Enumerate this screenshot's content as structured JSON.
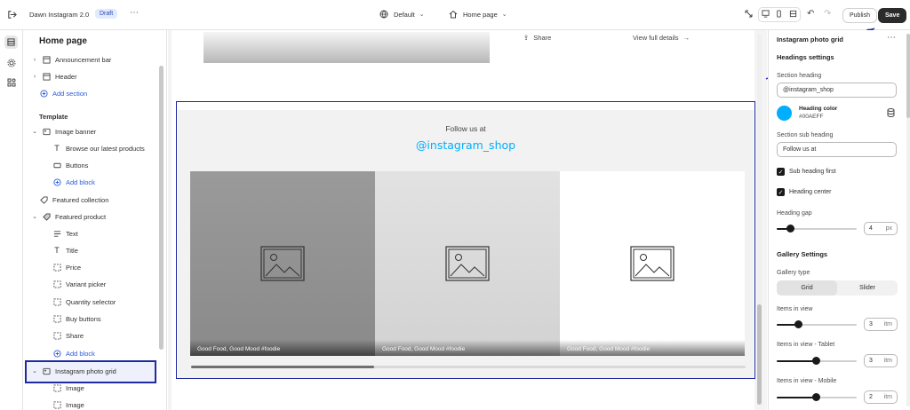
{
  "topbar": {
    "store_name": "Dawn Instagram 2.0",
    "status_badge": "Draft",
    "theme_select": "Default",
    "page_select": "Home page",
    "publish_label": "Publish",
    "save_label": "Save"
  },
  "sidebar": {
    "title": "Home page",
    "header_items": [
      {
        "label": "Announcement bar",
        "icon": "layout-icon"
      },
      {
        "label": "Header",
        "icon": "layout-icon"
      }
    ],
    "add_section_header": "Add section",
    "template_label": "Template",
    "image_banner": {
      "label": "Image banner",
      "blocks": [
        "Browse our latest products",
        "Buttons"
      ],
      "add_block": "Add block"
    },
    "featured_collection": "Featured collection",
    "featured_product": {
      "label": "Featured product",
      "blocks": [
        "Text",
        "Title",
        "Price",
        "Variant picker",
        "Quantity selector",
        "Buy buttons",
        "Share"
      ],
      "add_block": "Add block"
    },
    "instagram_grid": {
      "label": "Instagram photo grid",
      "blocks": [
        "Image",
        "Image"
      ]
    }
  },
  "preview": {
    "share_label": "Share",
    "view_details": "View full details",
    "sub_heading": "Follow us at",
    "heading": "@instagram_shop",
    "heading_color": "#00AEFF",
    "tiles": [
      {
        "caption": "Good Food, Good Mood #foodie"
      },
      {
        "caption": "Good Food, Good Mood #foodie"
      },
      {
        "caption": "Good Food, Good Mood #foodie"
      }
    ]
  },
  "settings": {
    "title": "Instagram photo grid",
    "headings_settings": "Headings settings",
    "section_heading_label": "Section heading",
    "section_heading_value": "@instagram_shop",
    "heading_color_label": "Heading color",
    "heading_color_value": "#00AEFF",
    "sub_heading_label": "Section sub heading",
    "sub_heading_value": "Follow us at",
    "sub_heading_first": "Sub heading first",
    "heading_center": "Heading center",
    "heading_gap_label": "Heading gap",
    "heading_gap_value": "4",
    "heading_gap_unit": "px",
    "gallery_settings": "Gallery Settings",
    "gallery_type_label": "Gallery type",
    "gallery_options": [
      "Grid",
      "Slider"
    ],
    "gallery_selected": "Grid",
    "items_in_view_label": "Items in view",
    "items_in_view_value": "3",
    "items_tablet_label": "Items in view - Tablet",
    "items_tablet_value": "3",
    "items_mobile_label": "Items in view - Mobile",
    "items_mobile_value": "2",
    "item_unit": "itm"
  }
}
